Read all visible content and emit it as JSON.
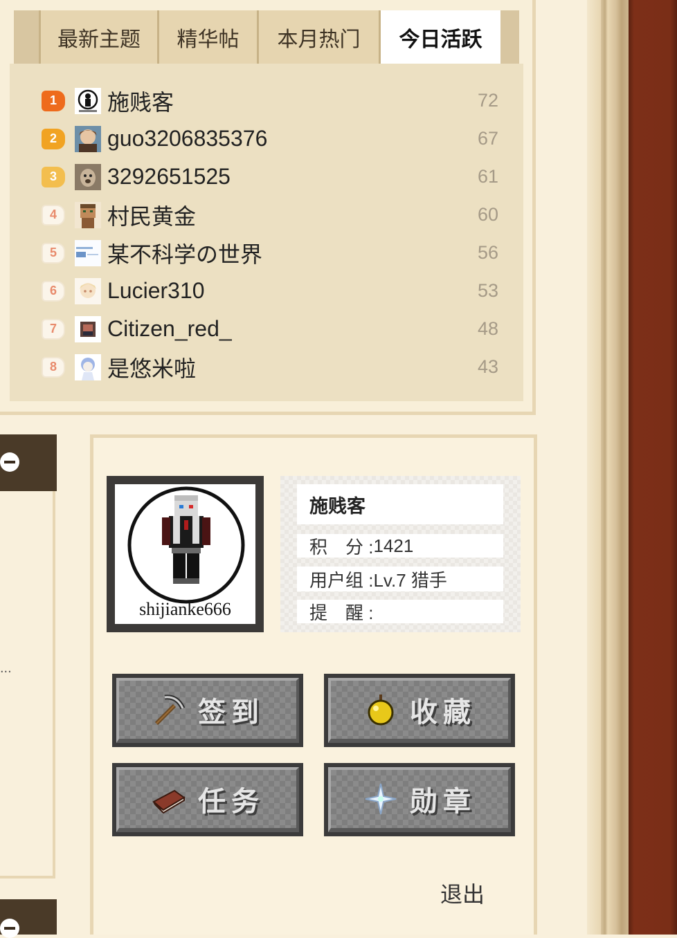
{
  "tabs": [
    {
      "label": "最新主题"
    },
    {
      "label": "精华帖"
    },
    {
      "label": "本月热门"
    },
    {
      "label": "今日活跃"
    }
  ],
  "active_tab": "今日活跃",
  "ranking": [
    {
      "rank": "1",
      "name": "施贱客",
      "score": "72"
    },
    {
      "rank": "2",
      "name": "guo3206835376",
      "score": "67"
    },
    {
      "rank": "3",
      "name": "3292651525",
      "score": "61"
    },
    {
      "rank": "4",
      "name": "村民黄金",
      "score": "60"
    },
    {
      "rank": "5",
      "name": "某不科学の世界",
      "score": "56"
    },
    {
      "rank": "6",
      "name": "Lucier310",
      "score": "53"
    },
    {
      "rank": "7",
      "name": "Citizen_red_",
      "score": "48"
    },
    {
      "rank": "8",
      "name": "是悠米啦",
      "score": "43"
    }
  ],
  "left": {
    "ellipsis": "..."
  },
  "profile": {
    "avatar_caption": "shijianke666",
    "username": "施贱客",
    "points_label": "积　分 : ",
    "points": "1421",
    "group_label": "用户组 : ",
    "group": "Lv.7 猎手",
    "remind_label": "提　醒 : ",
    "remind": ""
  },
  "actions": {
    "checkin": "签到",
    "favorite": "收藏",
    "task": "任务",
    "medal": "勋章"
  },
  "logout": "退出",
  "colors": {
    "page_bg": "#f9f0dc",
    "frame_dark": "#7a2e17",
    "rank1": "#ee6b1c",
    "rank2": "#f1a322",
    "rank3": "#f3be4e"
  }
}
